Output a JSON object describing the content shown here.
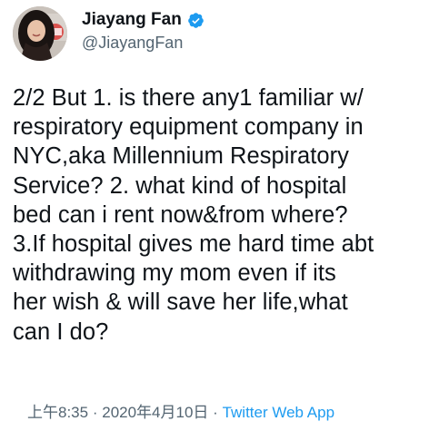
{
  "user": {
    "display_name": "Jiayang Fan",
    "handle": "@JiayangFan",
    "verified": true
  },
  "tweet": {
    "text": "2/2 But 1. is there any1 familiar w/\nrespiratory equipment company in\nNYC,aka Millennium Respiratory\nService? 2. what kind of hospital\nbed can i rent now&from where?\n3.If hospital gives me hard time abt\nwithdrawing my mom even if its\nher wish & will save her life,what\ncan I do?",
    "time": "上午8:35",
    "separator": "·",
    "date": "2020年4月10日",
    "source": "Twitter Web App"
  },
  "colors": {
    "text": "#0f1419",
    "secondary": "#536471",
    "accent": "#1d9bf0"
  }
}
